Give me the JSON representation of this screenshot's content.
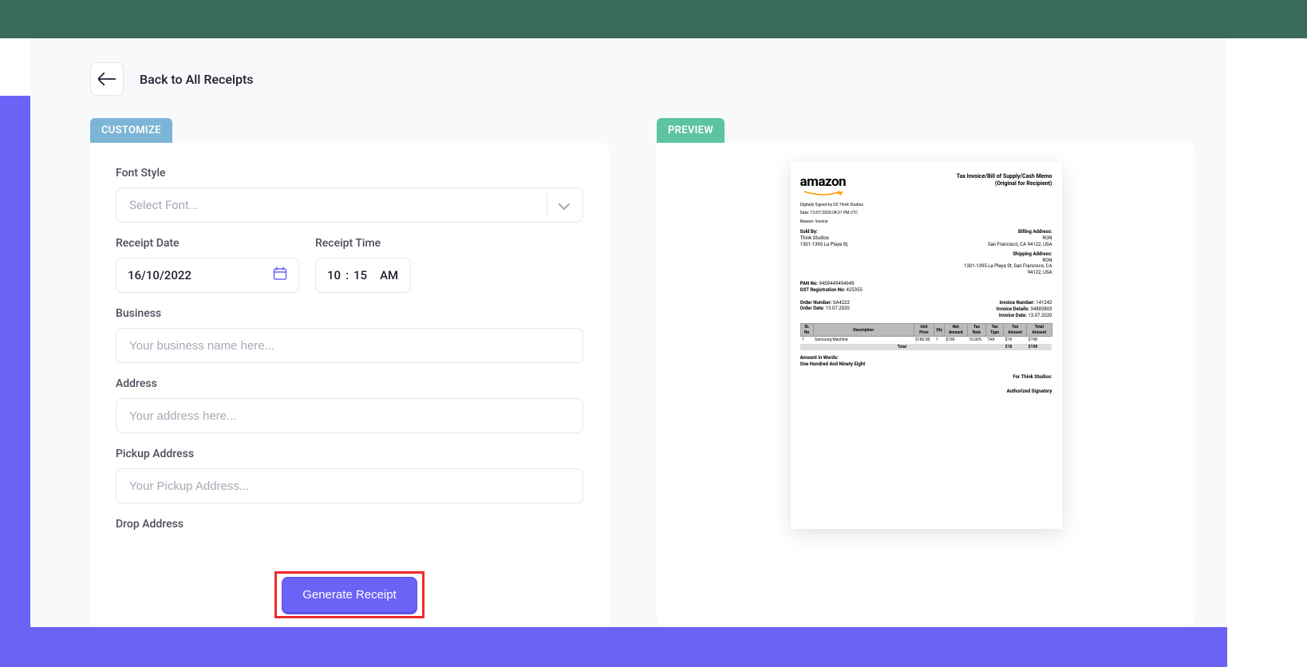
{
  "header": {
    "back_label": "Back to All Receipts"
  },
  "tags": {
    "customize": "CUSTOMIZE",
    "preview": "PREVIEW"
  },
  "form": {
    "font_label": "Font Style",
    "font_placeholder": "Select Font...",
    "date_label": "Receipt Date",
    "date_value": "16/10/2022",
    "time_label": "Receipt Time",
    "time_hour": "10",
    "time_min": "15",
    "time_ampm": "AM",
    "business_label": "Business",
    "business_placeholder": "Your business name here...",
    "address_label": "Address",
    "address_placeholder": "Your address here...",
    "pickup_label": "Pickup Address",
    "pickup_placeholder": "Your Pickup Address...",
    "drop_label": "Drop Address",
    "generate_label": "Generate Receipt"
  },
  "receipt": {
    "logo": "amazon",
    "title1": "Tax Invoice/Bill of Supply/Cash Memo",
    "title2": "(Original for Recipient)",
    "sig1": "Digitally Signed by DS Think Studios",
    "sig2": "Date: 13/07/2020  04:37 PM UTC",
    "sig3": "Reason: Invoice",
    "sold_by": "Sold By:",
    "seller1": "Think Studios",
    "seller2": "1301-1395 La Playa St,",
    "billing_label": "Billing Address:",
    "bill1": "RON",
    "bill2": "San Francisco, CA 94122, USA",
    "shipping_label": "Shipping Address:",
    "ship1": "RON",
    "ship2": "1301-1395 La Playa St, San Francisco, CA",
    "ship3": "94122, USA",
    "pan_label": "PAN No:",
    "pan_val": "94S9449494949",
    "gst_label": "GST Registration No:",
    "gst_val": "425355",
    "order_no_label": "Order Number:",
    "order_no": "SA4222",
    "order_date_label": "Order Date:",
    "order_date": "13.07.2020",
    "invoice_no_label": "Invoice Number:",
    "invoice_no": "141242",
    "invoice_det_label": "Invoice Details:",
    "invoice_det": "34883803",
    "invoice_date_label": "Invoice Date:",
    "invoice_date": "13.07.2020",
    "th": [
      "SL No",
      "Description",
      "Unit Price",
      "Qty",
      "Net Amount",
      "Tax Rate",
      "Tax Type",
      "Tax Amount",
      "Total Amount"
    ],
    "row": [
      "1",
      "Samsung Machine",
      "$180.00",
      "1",
      "$180",
      "10.00%",
      "TAX",
      "$18",
      "$198"
    ],
    "total_label": "Total",
    "total_tax": "$18",
    "total_amt": "$198",
    "words_label": "Amount in Words:",
    "words": "One Hundred And Ninety Eight",
    "for_label": "For Think Studios:",
    "auth": "Authorized Signatory"
  }
}
